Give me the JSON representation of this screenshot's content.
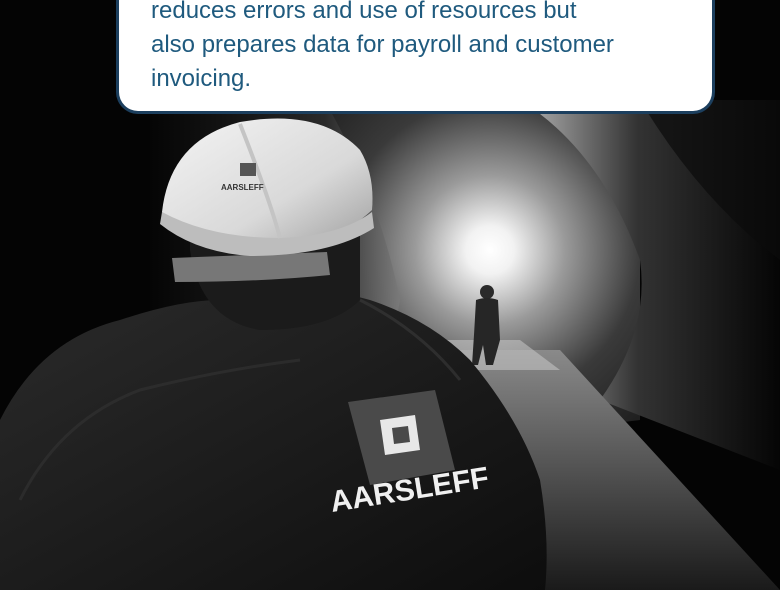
{
  "callout": {
    "lines": [
      "reduces errors and use of resources but",
      "also prepares data for payroll and customer",
      "invoicing."
    ]
  },
  "photo": {
    "helmet_brand": "AARSLEFF",
    "jacket_brand": "AARSLEFF"
  },
  "colors": {
    "callout_border": "#1c3f5e",
    "callout_text": "#1f5a7e",
    "callout_background": "#ffffff",
    "scene_background": "#000000"
  }
}
